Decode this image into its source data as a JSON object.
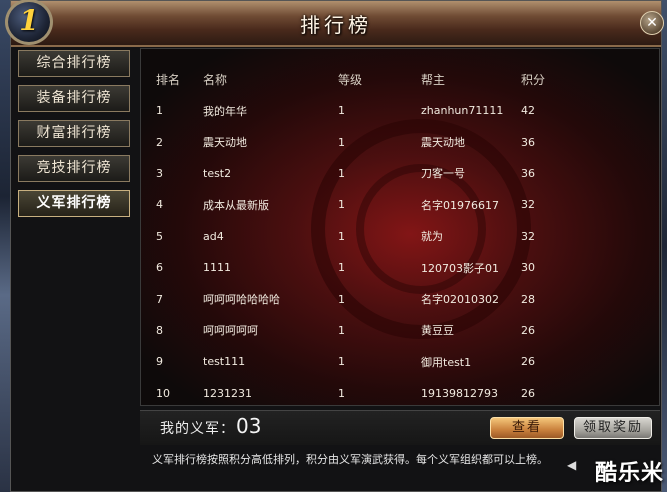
{
  "window": {
    "title": "排行榜",
    "badge_number": "1",
    "close_glyph": "✕"
  },
  "sidebar": {
    "tabs": [
      {
        "label": "综合排行榜",
        "active": false
      },
      {
        "label": "装备排行榜",
        "active": false
      },
      {
        "label": "财富排行榜",
        "active": false
      },
      {
        "label": "竞技排行榜",
        "active": false
      },
      {
        "label": "义军排行榜",
        "active": true
      }
    ]
  },
  "table": {
    "headers": [
      "排名",
      "名称",
      "等级",
      "帮主",
      "积分"
    ],
    "rows": [
      [
        "1",
        "我的年华",
        "1",
        "zhanhun71111",
        "42"
      ],
      [
        "2",
        "震天动地",
        "1",
        "震天动地",
        "36"
      ],
      [
        "3",
        "test2",
        "1",
        "刀客一号",
        "36"
      ],
      [
        "4",
        "成本从最新版",
        "1",
        "名字01976617",
        "32"
      ],
      [
        "5",
        "ad4",
        "1",
        "就为",
        "32"
      ],
      [
        "6",
        "1111",
        "1",
        "120703影子01",
        "30"
      ],
      [
        "7",
        "呵呵呵哈哈哈哈",
        "1",
        "名字02010302",
        "28"
      ],
      [
        "8",
        "呵呵呵呵呵",
        "1",
        "黄豆豆",
        "26"
      ],
      [
        "9",
        "test111",
        "1",
        "御用test1",
        "26"
      ],
      [
        "10",
        "1231231",
        "1",
        "19139812793",
        "26"
      ]
    ]
  },
  "footer": {
    "my_label": "我的义军：",
    "my_value": "03",
    "view_button": "查看",
    "claim_button": "领取奖励",
    "description": "义军排行榜按照积分高低排列，积分由义军演武获得。每个义军组织都可以上榜。",
    "pager_icon": "prev-page-icon",
    "watermark": "酷乐米"
  },
  "colors": {
    "panel_red": "#961616",
    "view_button": "#c9803c",
    "badge_number": "#ffd23c"
  }
}
